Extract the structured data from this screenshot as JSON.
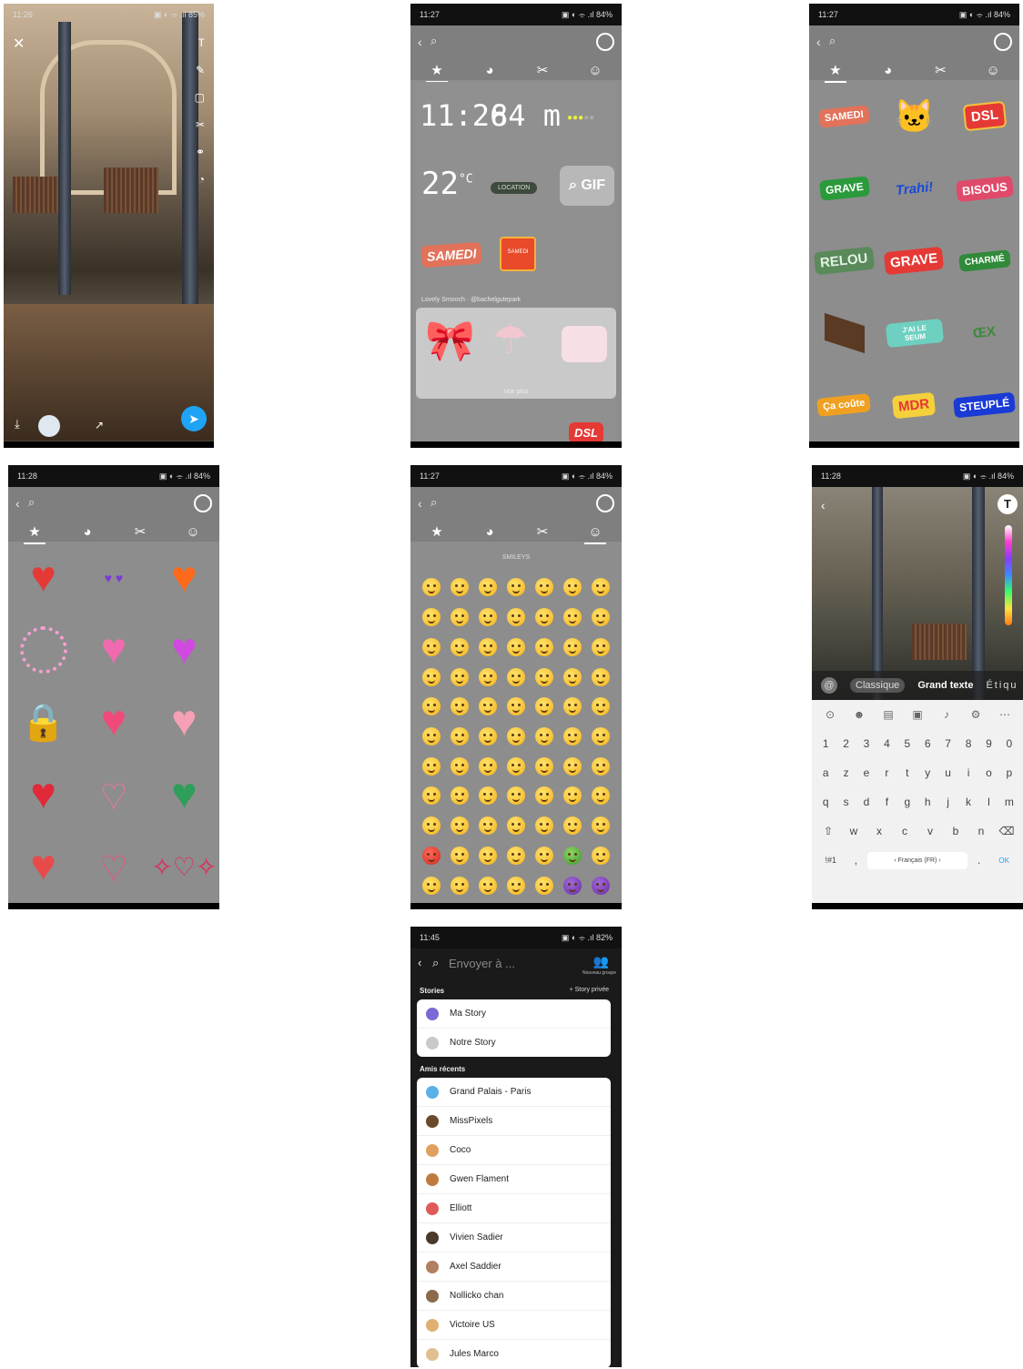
{
  "screens": {
    "camera": {
      "time": "11:26",
      "status_icons": "▣ ◐ ⌯ .ıl 85%"
    },
    "status": {
      "s2": {
        "time": "11:27",
        "icons": "▣ ◐ ⌯ .ıl 84%"
      },
      "s3": {
        "time": "11:27",
        "icons": "▣ ◐ ⌯ .ıl 84%"
      },
      "s4": {
        "time": "11:28",
        "icons": "▣ ◐ ⌯ .ıl 84%"
      },
      "s5": {
        "time": "11:27",
        "icons": "▣ ◐ ⌯ .ıl 84%"
      },
      "s6": {
        "time": "11:28",
        "icons": "▣ ◐ ⌯ .ıl 84%"
      },
      "s7": {
        "time": "11:45",
        "icons": "▣ ◐ ⌯ .ıl 82%"
      }
    },
    "stickers_main": {
      "clock": "11:26",
      "altitude": "84 m",
      "temperature": "22",
      "temp_unit": "°C",
      "location_pill": "LOCATION",
      "gif_button": "GIF",
      "sticker_samedi": "SAMEDI",
      "sticker_tv": "SAMEDI",
      "pack_title": "Lovely Smooch · @bachelgutepark",
      "pack_more": "Voir plus",
      "sticker_dsl": "DSL"
    },
    "word_stickers": [
      "SAMEDI",
      "DSL",
      "GRAVE",
      "Trahi!",
      "BISOUS",
      "RELOU",
      "GRAVE",
      "CHARMÉ",
      "J'AI LE SEUM",
      "ŒX",
      "Ça coûte",
      "MDR",
      "STEUPLÉ"
    ],
    "emoji_section": "SMILEYS",
    "text_editor": {
      "styles": [
        "Classique",
        "Grand texte",
        "Étiqu"
      ],
      "keyboard_rows": [
        [
          "1",
          "2",
          "3",
          "4",
          "5",
          "6",
          "7",
          "8",
          "9",
          "0"
        ],
        [
          "a",
          "z",
          "e",
          "r",
          "t",
          "y",
          "u",
          "i",
          "o",
          "p"
        ],
        [
          "q",
          "s",
          "d",
          "f",
          "g",
          "h",
          "j",
          "k",
          "l",
          "m"
        ],
        [
          "⇧",
          "w",
          "x",
          "c",
          "v",
          "b",
          "n",
          "⌫"
        ]
      ],
      "space_label": "‹ Français (FR) ›",
      "sym_key": "!#1",
      "ok_key": "OK"
    },
    "send_to": {
      "search_placeholder": "Envoyer à ...",
      "new_group": "Nouveau groupe",
      "stories_label": "Stories",
      "private_story": "+ Story privée",
      "stories": [
        "Ma Story",
        "Notre Story"
      ],
      "recent_label": "Amis récents",
      "recent": [
        "Grand Palais - Paris",
        "MissPixels",
        "Coco",
        "Gwen Flament",
        "Elliott",
        "Vivien Sadier",
        "Axel Saddier",
        "Nollicko chan",
        "Victoire US",
        "Jules Marco"
      ]
    }
  },
  "colors": {
    "accent": "#1fa3f5",
    "heart_red": "#e53935",
    "heart_green": "#2e9e5a"
  }
}
